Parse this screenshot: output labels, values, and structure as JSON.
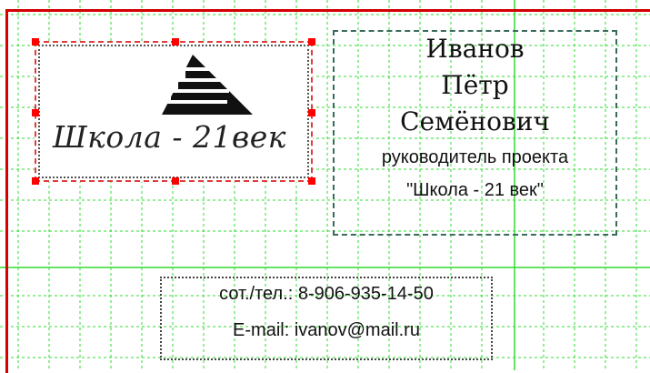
{
  "card": {
    "logo": {
      "mark_icon": "stepped-triangle-logo-icon",
      "text": "Школа - 21век"
    },
    "person": {
      "surname": "Иванов",
      "first_name": "Пётр",
      "patronymic": "Семёнович",
      "role_line1": "руководитель проекта",
      "role_line2": "\"Школа - 21 век\""
    },
    "contacts": {
      "phone": "сот./тел.: 8-906-935-14-50",
      "email": "E-mail: ivanov@mail.ru"
    }
  },
  "colors": {
    "grid_line": "#32dc32",
    "page_border": "#d40000",
    "selection_handle": "#ff0000",
    "name_frame": "#3a6b5e"
  }
}
